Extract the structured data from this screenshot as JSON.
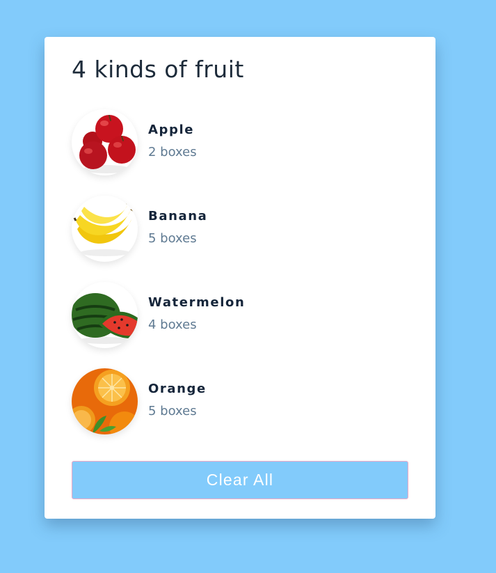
{
  "card": {
    "title": "4 kinds of fruit",
    "items": [
      {
        "name": "Apple",
        "qty": "2 boxes",
        "icon": "apple-icon"
      },
      {
        "name": "Banana",
        "qty": "5 boxes",
        "icon": "banana-icon"
      },
      {
        "name": "Watermelon",
        "qty": "4 boxes",
        "icon": "watermelon-icon"
      },
      {
        "name": "Orange",
        "qty": "5 boxes",
        "icon": "orange-icon"
      }
    ],
    "clear_label": "Clear All"
  },
  "colors": {
    "page_background": "#82cbfb",
    "card_background": "#ffffff",
    "button_background": "#82cbfb",
    "button_border": "#f2a7c4",
    "title_text": "#1d2b3a",
    "secondary_text": "#5f7a92"
  }
}
